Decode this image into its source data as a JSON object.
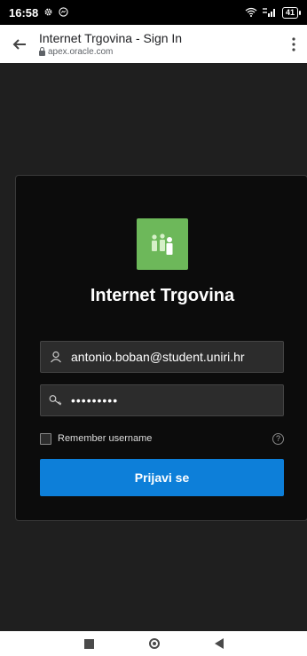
{
  "status_bar": {
    "time": "16:58",
    "battery": "41"
  },
  "browser": {
    "page_title": "Internet Trgovina - Sign In",
    "url": "apex.oracle.com"
  },
  "login": {
    "app_title": "Internet Trgovina",
    "username_value": "antonio.boban@student.uniri.hr",
    "password_value": "•••••••••",
    "remember_label": "Remember username",
    "remember_checked": false,
    "signin_label": "Prijavi se"
  },
  "colors": {
    "accent": "#0d7fd9",
    "logo": "#6db85a",
    "card_bg": "#0c0c0c",
    "page_bg": "#1f1f1f"
  }
}
